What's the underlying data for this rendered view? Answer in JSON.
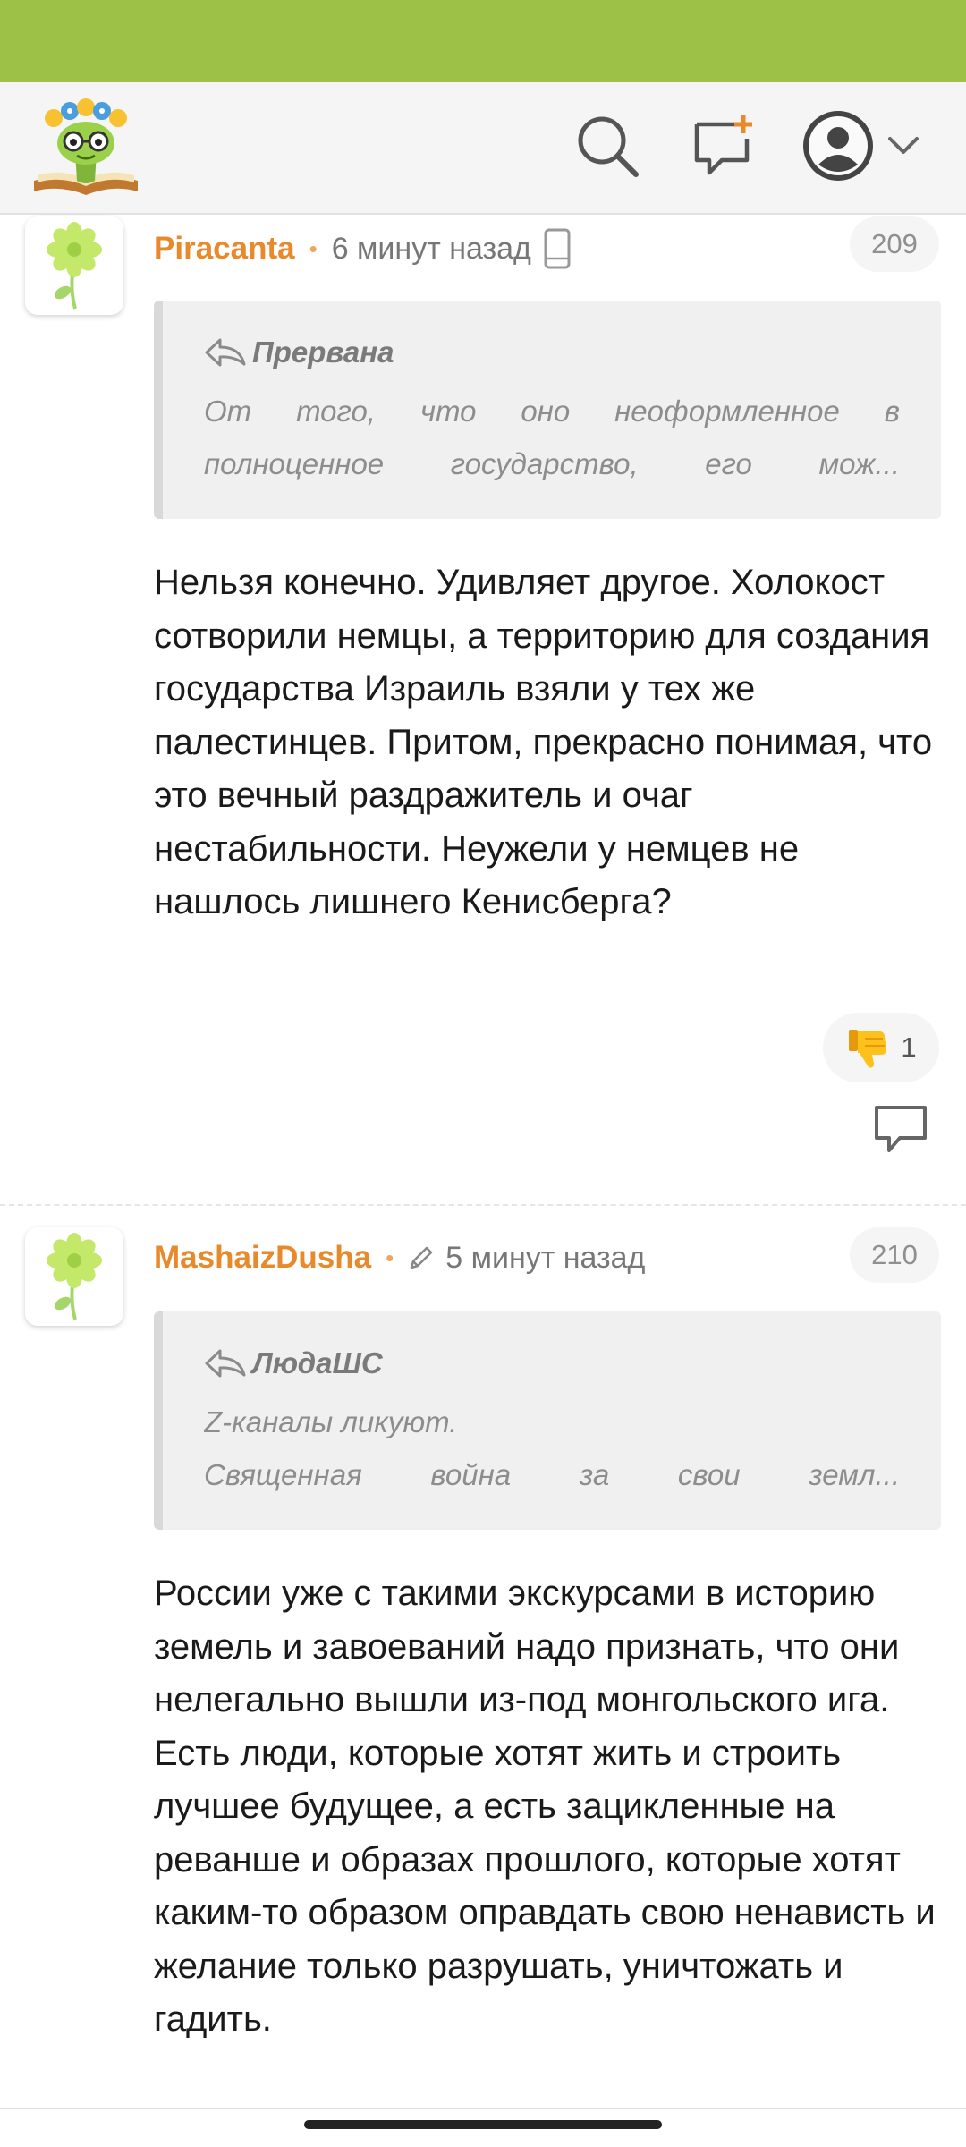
{
  "header": {
    "logo_icon": "bookworm-logo-icon",
    "search_icon": "search-icon",
    "new_message_icon": "new-message-icon",
    "avatar_icon": "user-avatar-icon",
    "chevron_icon": "chevron-down-icon"
  },
  "colors": {
    "status_bar": "#9dc146",
    "author": "#e8892b",
    "quote_bg": "#f0f0f0"
  },
  "comments": [
    {
      "author": "Piracanta",
      "time": "6 минут назад",
      "device_icon": "mobile-device-icon",
      "number": "209",
      "quote": {
        "author": "Прервана",
        "lines": [
          "От того, что оно неоформленное в",
          "полноценное государство, его мож..."
        ]
      },
      "body": [
        "Нельзя конечно. Удивляет другое. Холокост сотворили немцы, а территорию для создания государства Израиль взяли у тех же палестинцев. Притом, прекрасно понимая, что это вечный раздражитель и очаг нестабильности. Неужели у немцев не нашлось лишнего Кенисберга?"
      ],
      "reaction": {
        "icon": "thumbs-down-icon",
        "count": "1"
      },
      "reply_icon": "reply-comment-icon"
    },
    {
      "author": "MashaizDusha",
      "time": "5 минут назад",
      "edited_icon": "pencil-icon",
      "number": "210",
      "quote": {
        "author": "ЛюдаШС",
        "lines": [
          "Z-каналы ликуют.",
          "Священная война за свои земл..."
        ]
      },
      "body": [
        "России уже с такими экскурсами в историю земель и завоеваний надо признать, что они нелегально вышли из-под монгольского ига.",
        "Есть люди, которые хотят жить и строить лучшее будущее, а есть зацикленные на реванше и образах прошлого, которые хотят каким-то образом оправдать свою ненависть и желание только разрушать, уничтожать и гадить."
      ]
    }
  ]
}
